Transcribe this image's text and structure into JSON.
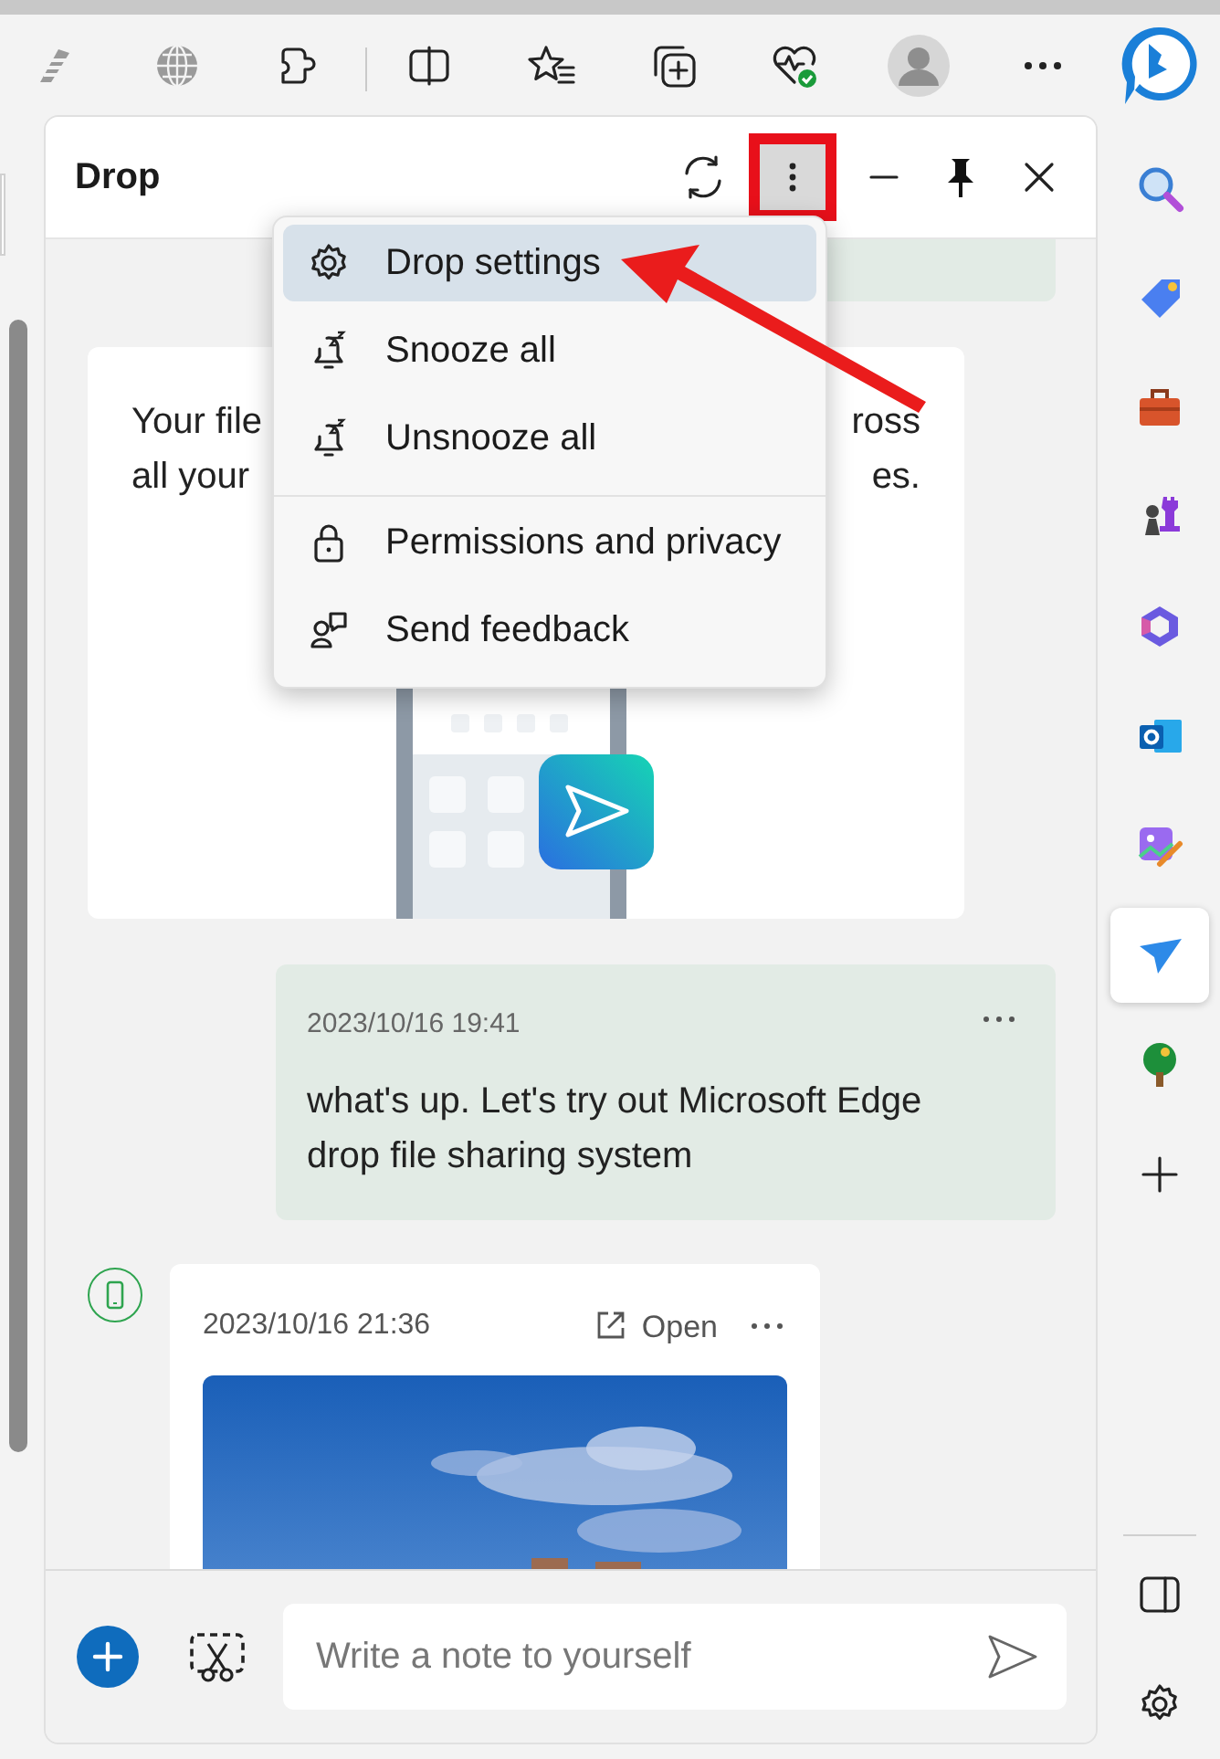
{
  "panel": {
    "title": "Drop"
  },
  "menu": {
    "groups": [
      [
        {
          "label": "Drop settings",
          "selected": true
        },
        {
          "label": "Snooze all",
          "selected": false
        },
        {
          "label": "Unsnooze all",
          "selected": false
        }
      ],
      [
        {
          "label": "Permissions and privacy",
          "selected": false
        },
        {
          "label": "Send feedback",
          "selected": false
        }
      ]
    ]
  },
  "intro_card": {
    "text_left": [
      "Your file",
      "all your"
    ],
    "text_right": [
      "ross",
      "es."
    ]
  },
  "messages": [
    {
      "kind": "note",
      "time": "2023/10/16 19:41",
      "text": "what's up. Let's try out Microsoft Edge drop file sharing system"
    },
    {
      "time": "2023/10/16 21:36",
      "open_label": "Open"
    }
  ],
  "composer": {
    "placeholder": "Write a note to yourself"
  },
  "sidebar": {
    "items": [
      {
        "selected": false
      },
      {
        "selected": false
      },
      {
        "selected": false
      },
      {
        "selected": false
      },
      {
        "selected": false
      },
      {
        "selected": false
      },
      {
        "selected": false
      },
      {
        "selected": true
      },
      {
        "selected": false
      },
      {
        "selected": false
      }
    ]
  }
}
